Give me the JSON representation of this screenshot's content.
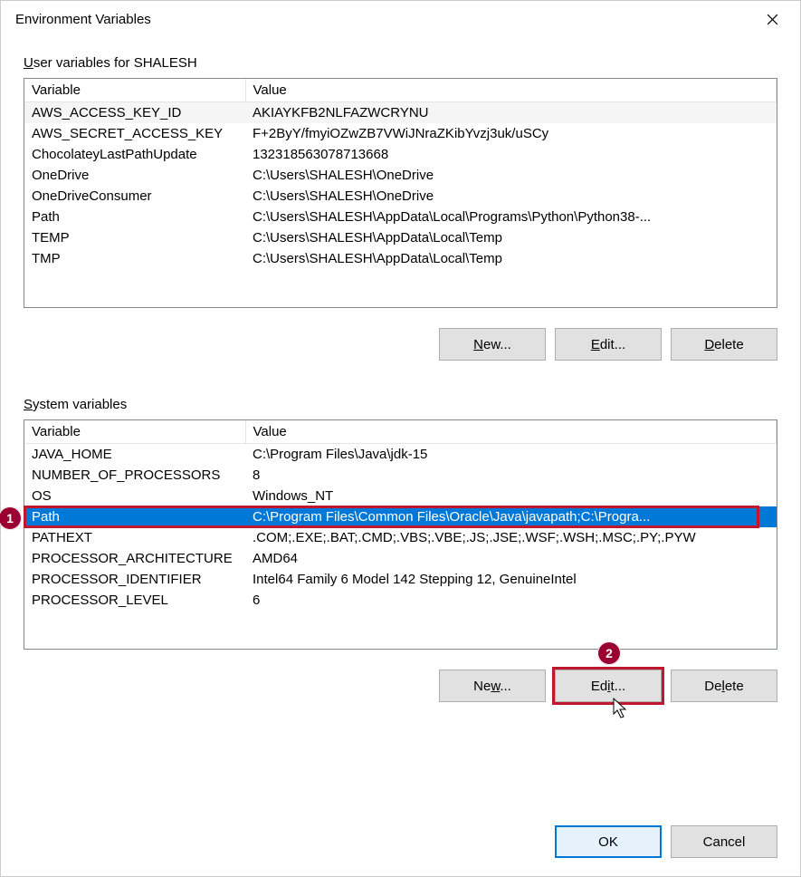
{
  "dialog": {
    "title": "Environment Variables"
  },
  "userSection": {
    "label_pre": "U",
    "label_rest": "ser variables for SHALESH",
    "headers": {
      "variable": "Variable",
      "value": "Value"
    },
    "rows": [
      {
        "variable": "AWS_ACCESS_KEY_ID",
        "value": "AKIAYKFB2NLFAZWCRYNU"
      },
      {
        "variable": "AWS_SECRET_ACCESS_KEY",
        "value": "F+2ByY/fmyiOZwZB7VWiJNraZKibYvzj3uk/uSCy"
      },
      {
        "variable": "ChocolateyLastPathUpdate",
        "value": "132318563078713668"
      },
      {
        "variable": "OneDrive",
        "value": "C:\\Users\\SHALESH\\OneDrive"
      },
      {
        "variable": "OneDriveConsumer",
        "value": "C:\\Users\\SHALESH\\OneDrive"
      },
      {
        "variable": "Path",
        "value": "C:\\Users\\SHALESH\\AppData\\Local\\Programs\\Python\\Python38-..."
      },
      {
        "variable": "TEMP",
        "value": "C:\\Users\\SHALESH\\AppData\\Local\\Temp"
      },
      {
        "variable": "TMP",
        "value": "C:\\Users\\SHALESH\\AppData\\Local\\Temp"
      }
    ],
    "buttons": {
      "new": "New...",
      "edit": "Edit...",
      "delete": "Delete"
    }
  },
  "systemSection": {
    "label_pre": "S",
    "label_rest": "ystem variables",
    "headers": {
      "variable": "Variable",
      "value": "Value"
    },
    "rows": [
      {
        "variable": "JAVA_HOME",
        "value": "C:\\Program Files\\Java\\jdk-15"
      },
      {
        "variable": "NUMBER_OF_PROCESSORS",
        "value": "8"
      },
      {
        "variable": "OS",
        "value": "Windows_NT"
      },
      {
        "variable": "Path",
        "value": "C:\\Program Files\\Common Files\\Oracle\\Java\\javapath;C:\\Progra...",
        "selected": true
      },
      {
        "variable": "PATHEXT",
        "value": ".COM;.EXE;.BAT;.CMD;.VBS;.VBE;.JS;.JSE;.WSF;.WSH;.MSC;.PY;.PYW"
      },
      {
        "variable": "PROCESSOR_ARCHITECTURE",
        "value": "AMD64"
      },
      {
        "variable": "PROCESSOR_IDENTIFIER",
        "value": "Intel64 Family 6 Model 142 Stepping 12, GenuineIntel"
      },
      {
        "variable": "PROCESSOR_LEVEL",
        "value": "6"
      }
    ],
    "buttons": {
      "new": "New...",
      "edit": "Edit...",
      "delete": "Delete"
    }
  },
  "footer": {
    "ok": "OK",
    "cancel": "Cancel"
  },
  "annotations": {
    "one": "1",
    "two": "2"
  }
}
